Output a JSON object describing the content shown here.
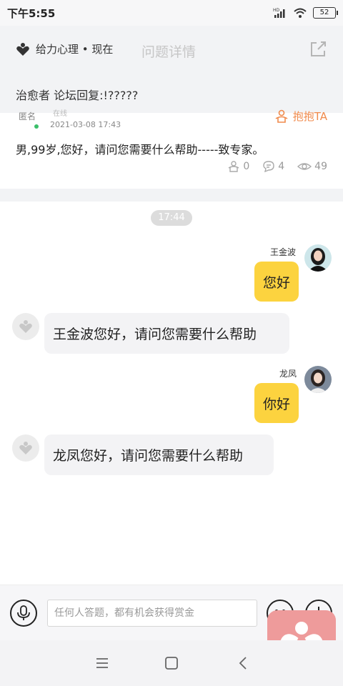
{
  "status": {
    "time": "下午5:55",
    "battery": "52",
    "hd": "HD"
  },
  "header": {
    "brand": "给力心理 • 现在",
    "title": "问题详情"
  },
  "question": {
    "title": "治愈者 论坛回复:!?????",
    "author": "匿名",
    "online": "在线",
    "date": "2021-03-08 17:43",
    "hug_label": "抱抱TA",
    "body": "男,99岁,您好，请问您需要什么帮助-----致专家。",
    "stats": {
      "hugs": "0",
      "comments": "4",
      "views": "49"
    }
  },
  "chat": {
    "time_chip": "17:44",
    "messages": [
      {
        "side": "right",
        "name": "王金波",
        "text": "您好"
      },
      {
        "side": "left",
        "text": "王金波您好，请问您需要什么帮助"
      },
      {
        "side": "right",
        "name": "龙凤",
        "text": "你好"
      },
      {
        "side": "left",
        "text": "龙凤您好，请问您需要什么帮助"
      }
    ]
  },
  "input": {
    "placeholder": "任何人答题，都有机会获得赏金"
  },
  "colors": {
    "bubble_user": "#fcd33f",
    "bubble_bot": "#f3f3f5",
    "accent": "#f08a4b",
    "floating_app": "#ee9b9b"
  },
  "icons": [
    "heart-logo-icon",
    "share-icon",
    "hug-icon",
    "comment-icon",
    "eye-icon",
    "mic-icon",
    "emoji-icon",
    "plus-icon",
    "menu-icon",
    "home-icon",
    "back-icon"
  ]
}
